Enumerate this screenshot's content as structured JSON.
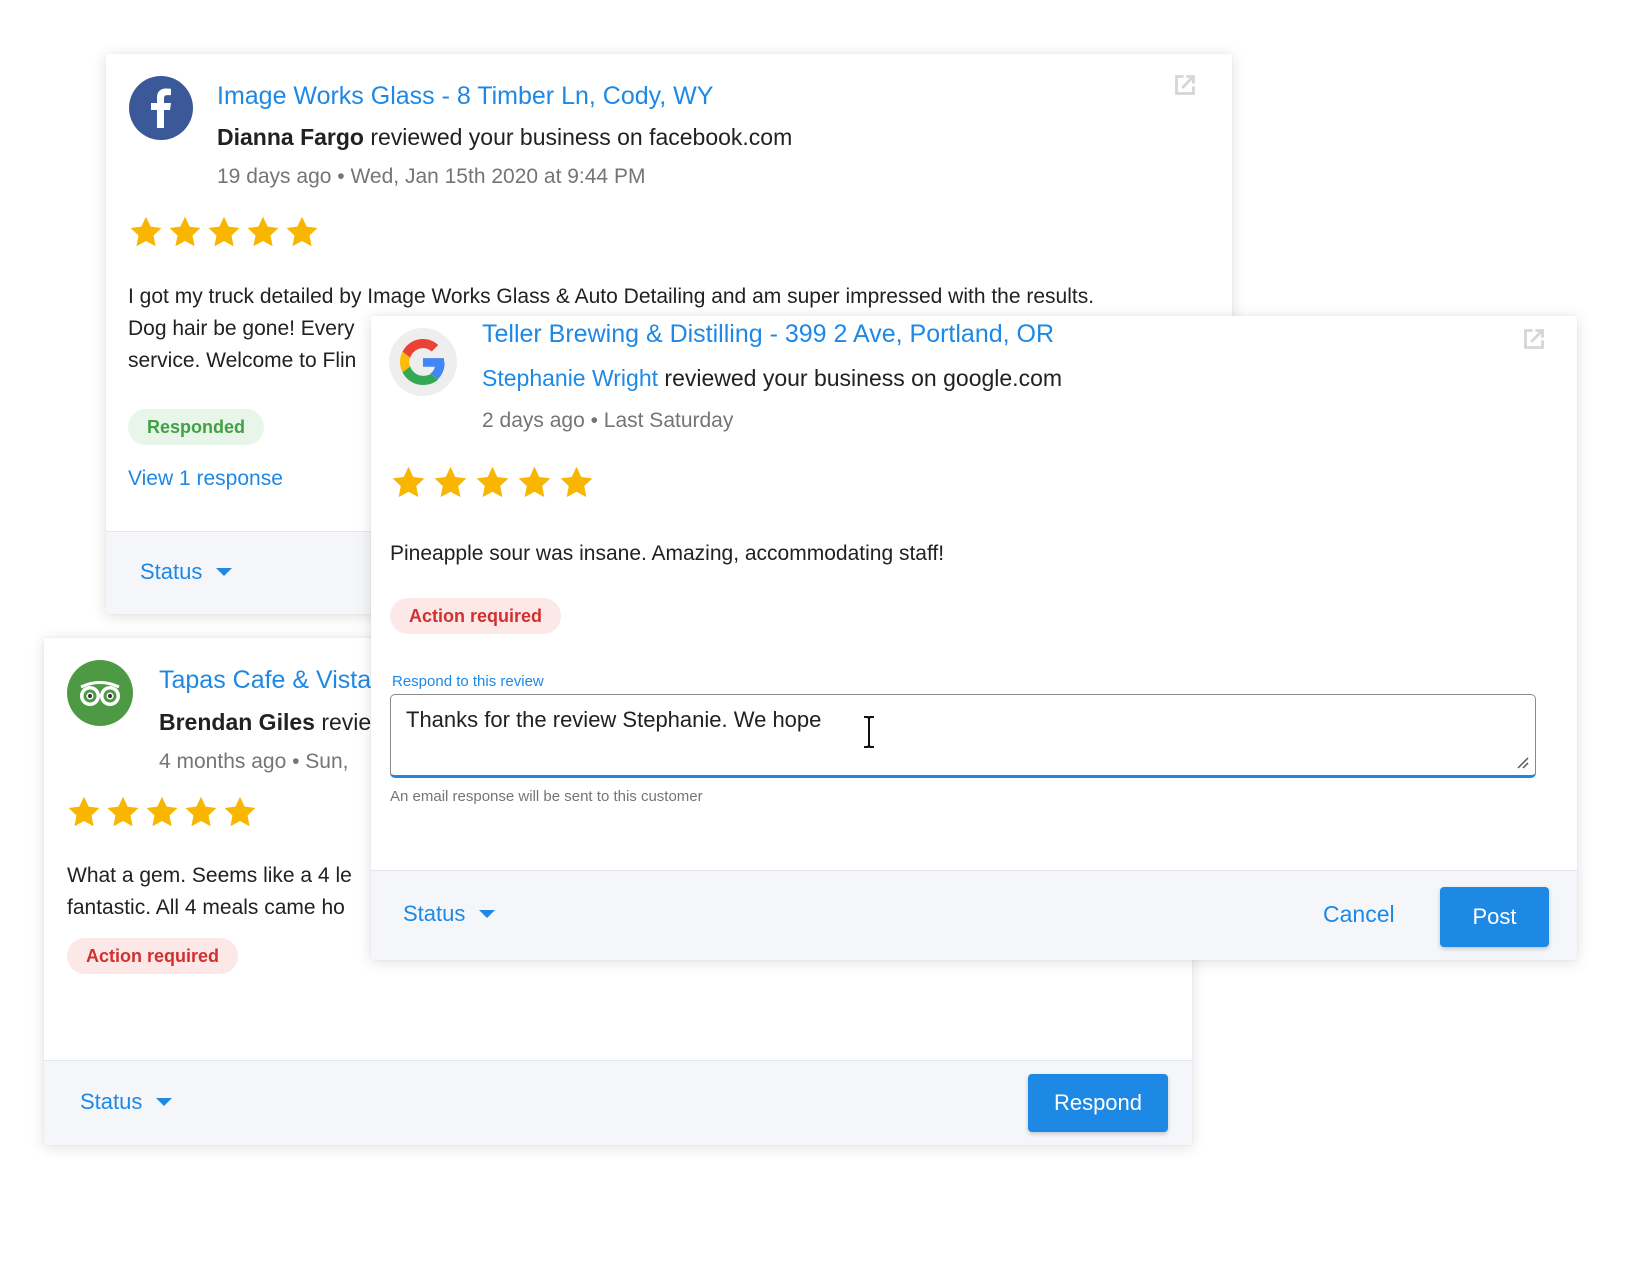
{
  "colors": {
    "accent": "#1e88e5",
    "star": "#f9b600",
    "facebook": "#3b5998",
    "tripadvisor": "#4e9a44",
    "responded": "#43a047",
    "action_required": "#d32f2f"
  },
  "reviews": [
    {
      "source_icon": "facebook-icon",
      "title": "Image Works Glass - 8 Timber Ln, Cody, WY",
      "reviewer": "Dianna Fargo",
      "reviewed_text": " reviewed your business on facebook.com",
      "time_ago": "19 days ago",
      "date": "Wed, Jan 15th 2020 at 9:44 PM",
      "rating": 5,
      "body_lines": [
        "I got my truck detailed by Image Works Glass & Auto Detailing and am super impressed with the results.",
        "Dog hair be gone! Every",
        "service. Welcome to Flin"
      ],
      "status_badge": "Responded",
      "view_response_link": "View 1 response",
      "status_label": "Status"
    },
    {
      "source_icon": "tripadvisor-icon",
      "title": "Tapas Cafe & Vista",
      "reviewer": "Brendan Giles",
      "reviewed_text": " revie",
      "time_ago": "4 months ago",
      "date": "Sun, ",
      "rating": 5,
      "body_lines": [
        "What a gem. Seems like a 4 le",
        "fantastic. All 4 meals came ho"
      ],
      "status_badge": "Action required",
      "status_label": "Status",
      "respond_button": "Respond"
    },
    {
      "source_icon": "google-icon",
      "title": "Teller Brewing & Distilling - 399 2 Ave, Portland, OR",
      "reviewer": "Stephanie Wright",
      "reviewed_text": " reviewed your business on google.com",
      "time_ago": "2 days ago",
      "date": "Last Saturday",
      "rating": 5,
      "body_lines": [
        "Pineapple sour was insane. Amazing, accommodating staff!"
      ],
      "status_badge": "Action required",
      "response_field": {
        "label": "Respond to this review",
        "value": "Thanks for the review Stephanie. We hope",
        "helper": "An email response will be sent to this customer"
      },
      "status_label": "Status",
      "cancel_button": "Cancel",
      "post_button": "Post"
    }
  ],
  "meta_separator": " • "
}
